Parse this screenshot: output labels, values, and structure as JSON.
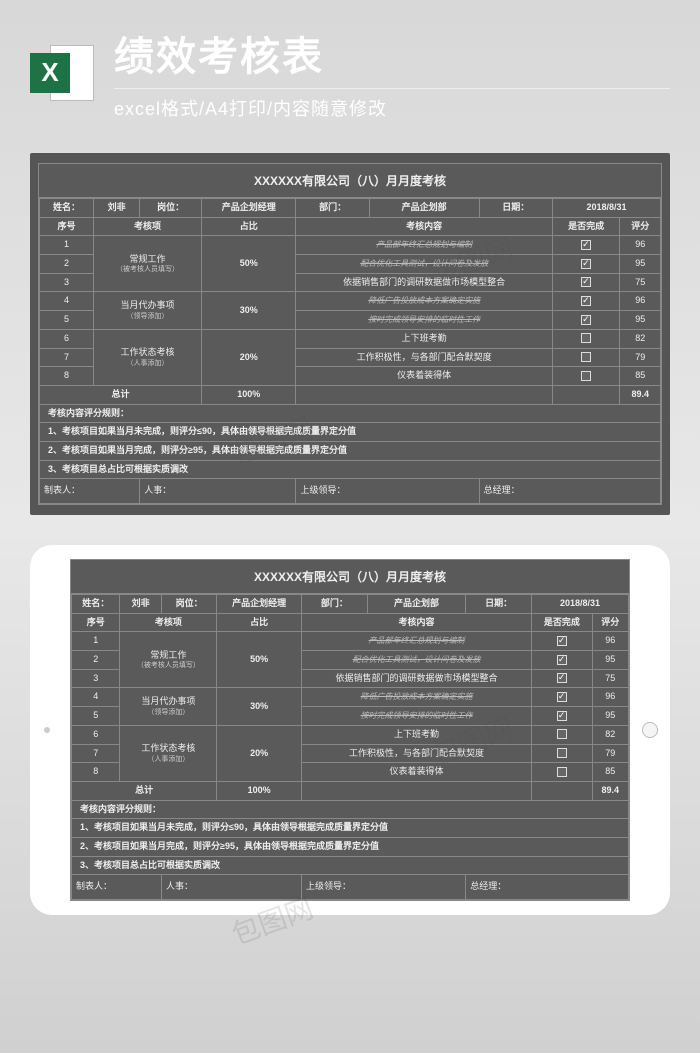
{
  "header": {
    "title_main": "绩效考核表",
    "title_sub": "excel格式/A4打印/内容随意修改",
    "logo_letter": "X"
  },
  "sheet": {
    "title": "XXXXXX有限公司（八）月月度考核",
    "info": {
      "name_lbl": "姓名：",
      "name_val": "刘非",
      "pos_lbl": "岗位：",
      "pos_val": "产品企划经理",
      "dept_lbl": "部门：",
      "dept_val": "产品企划部",
      "date_lbl": "日期：",
      "date_val": "2018/8/31"
    },
    "cols": {
      "seq": "序号",
      "item": "考核项",
      "weight": "占比",
      "content": "考核内容",
      "done": "是否完成",
      "score": "评分"
    },
    "groups": [
      {
        "item": "常规工作",
        "note": "（被考核人员填写）",
        "weight": "50%",
        "rows": [
          {
            "seq": "1",
            "content": "产品部年终汇总规划与编制",
            "done": true,
            "score": "96",
            "strike": true
          },
          {
            "seq": "2",
            "content": "配合优化工具测试，设计问卷及发放",
            "done": true,
            "score": "95",
            "strike": true
          },
          {
            "seq": "3",
            "content": "依据销售部门的调研数据做市场模型整合",
            "done": true,
            "score": "75",
            "strike": false
          }
        ]
      },
      {
        "item": "当月代办事项",
        "note": "（领导添加）",
        "weight": "30%",
        "rows": [
          {
            "seq": "4",
            "content": "降低广告投放成本方案确定实施",
            "done": true,
            "score": "96",
            "strike": true
          },
          {
            "seq": "5",
            "content": "按时完成领导安排的临时性工作",
            "done": true,
            "score": "95",
            "strike": true
          }
        ]
      },
      {
        "item": "工作状态考核",
        "note": "（人事添加）",
        "weight": "20%",
        "rows": [
          {
            "seq": "6",
            "content": "上下班考勤",
            "done": false,
            "score": "82",
            "strike": false
          },
          {
            "seq": "7",
            "content": "工作积极性，与各部门配合默契度",
            "done": false,
            "score": "79",
            "strike": false
          },
          {
            "seq": "8",
            "content": "仪表着装得体",
            "done": false,
            "score": "85",
            "strike": false
          }
        ]
      }
    ],
    "total": {
      "label": "总计",
      "weight": "100%",
      "score": "89.4"
    },
    "rules_hdr": "考核内容评分规则：",
    "rules": [
      "1、考核项目如果当月未完成，则评分≤90，具体由领导根据完成质量界定分值",
      "2、考核项目如果当月完成，则评分≥95，具体由领导根据完成质量界定分值",
      "3、考核项目总占比可根据实质调改"
    ],
    "sign": {
      "maker": "制表人：",
      "hr": "人事：",
      "leader": "上级领导：",
      "manager": "总经理："
    }
  }
}
